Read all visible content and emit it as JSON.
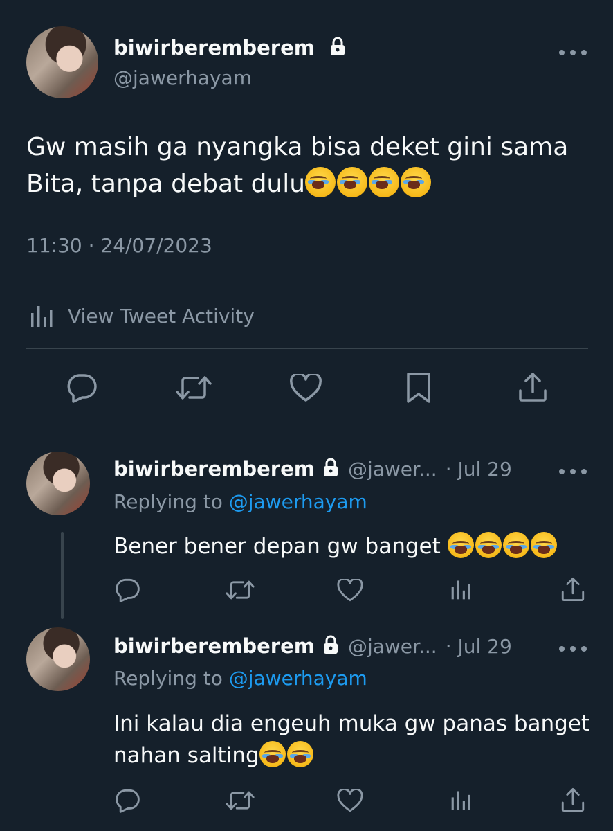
{
  "colors": {
    "background": "#15202b",
    "text_primary": "#f7f9f9",
    "text_secondary": "#8b98a5",
    "link": "#1d9bf0",
    "divider": "#38444d"
  },
  "main_tweet": {
    "display_name": "biwirberemberem",
    "handle": "@jawerhayam",
    "text_line1": "Gw masih ga nyangka bisa deket gini sama",
    "text_line2": "Bita, tanpa debat dulu",
    "emoji_count": 4,
    "timestamp": "11:30 · 24/07/2023",
    "activity_label": "View Tweet Activity",
    "more_icon": "more-dots-icon"
  },
  "replies": [
    {
      "display_name": "biwirberemberem",
      "handle": "@jawer...",
      "date": "· Jul 29",
      "replying_prefix": "Replying to",
      "replying_handle": "@jawerhayam",
      "text_line1": "Bener bener depan gw banget ",
      "text_line2": "",
      "emoji_count": 4
    },
    {
      "display_name": "biwirberemberem",
      "handle": "@jawer...",
      "date": "· Jul 29",
      "replying_prefix": "Replying to",
      "replying_handle": "@jawerhayam",
      "text_line1": "Ini kalau dia engeuh muka gw panas banget",
      "text_line2": "nahan salting",
      "emoji_count": 2
    }
  ]
}
